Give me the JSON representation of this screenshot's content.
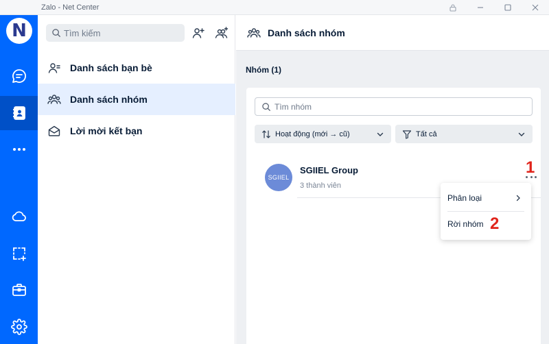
{
  "window": {
    "title": "Zalo - Net Center"
  },
  "rail": {
    "avatar_letter": "N",
    "items": [
      {
        "name": "messages",
        "icon": "chat-bubble-icon"
      },
      {
        "name": "contacts",
        "icon": "contacts-book-icon",
        "active": true
      },
      {
        "name": "more",
        "icon": "more-dots-icon"
      },
      {
        "name": "cloud",
        "icon": "cloud-icon"
      },
      {
        "name": "screenshot",
        "icon": "screenshot-icon"
      },
      {
        "name": "toolbox",
        "icon": "briefcase-icon"
      },
      {
        "name": "settings",
        "icon": "gear-icon"
      }
    ]
  },
  "sidebar": {
    "search_placeholder": "Tìm kiếm",
    "menu": [
      {
        "label": "Danh sách bạn bè",
        "icon": "friends-list-icon"
      },
      {
        "label": "Danh sách nhóm",
        "icon": "groups-icon",
        "active": true
      },
      {
        "label": "Lời mời kết bạn",
        "icon": "envelope-open-icon"
      }
    ]
  },
  "main": {
    "header_title": "Danh sách nhóm",
    "group_count_label": "Nhóm (1)",
    "search_placeholder": "Tìm nhóm",
    "sort_label": "Hoạt động (mới → cũ)",
    "filter_label": "Tất cả",
    "groups": [
      {
        "avatar_text": "SGIIEL",
        "name": "SGIIEL Group",
        "members": "3 thành viên"
      }
    ]
  },
  "context_menu": {
    "items": [
      {
        "label": "Phân loại"
      },
      {
        "label": "Rời nhóm"
      }
    ]
  },
  "annotations": {
    "step1": "1",
    "step2": "2"
  },
  "colors": {
    "brand_blue": "#0068ff",
    "active_rail": "#0050c7",
    "active_item_bg": "#e5efff",
    "annotation_red": "#e0241b"
  }
}
